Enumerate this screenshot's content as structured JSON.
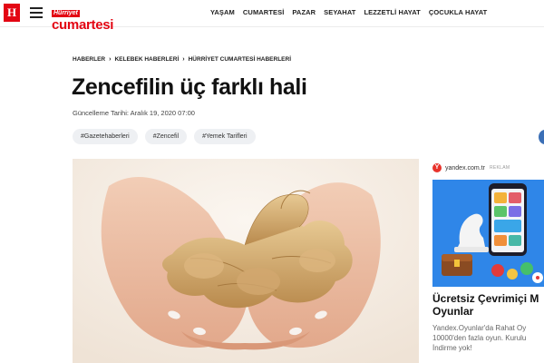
{
  "header": {
    "logo_letter": "H",
    "brand_top": "Hürriyet",
    "brand_main": "cumartesi",
    "nav": [
      "YAŞAM",
      "CUMARTESİ",
      "PAZAR",
      "SEYAHAT",
      "LEZZETLİ HAYAT",
      "ÇOCUKLA HAYAT"
    ]
  },
  "breadcrumb": [
    "HABERLER",
    "KELEBEK HABERLERİ",
    "HÜRRİYET CUMARTESİ HABERLERİ"
  ],
  "article": {
    "title": "Zencefilin üç farklı hali",
    "updated": "Güncelleme Tarihi: Aralık 19, 2020 07:00",
    "tags": [
      "#Gazetehaberleri",
      "#Zencefil",
      "#Yemek Tarifleri"
    ]
  },
  "ad": {
    "source": "yandex.com.tr",
    "label": "REKLAM",
    "title_line1": "Ücretsiz Çevrimiçi M",
    "title_line2": "Oyunlar",
    "desc_line1": "Yandex.Oyunlar'da Rahat Oy",
    "desc_line2": "10000'den fazla oyun. Kurulu",
    "desc_line3": "İndirme yok!"
  },
  "colors": {
    "brand_red": "#e30613",
    "ad_blue": "#2f86e8",
    "tag_bg": "#eef0f3"
  },
  "icons": {
    "menu": "hamburger-icon",
    "logo": "hurriyet-logo",
    "share": "share-icon",
    "ad_brand": "yandex-icon"
  }
}
